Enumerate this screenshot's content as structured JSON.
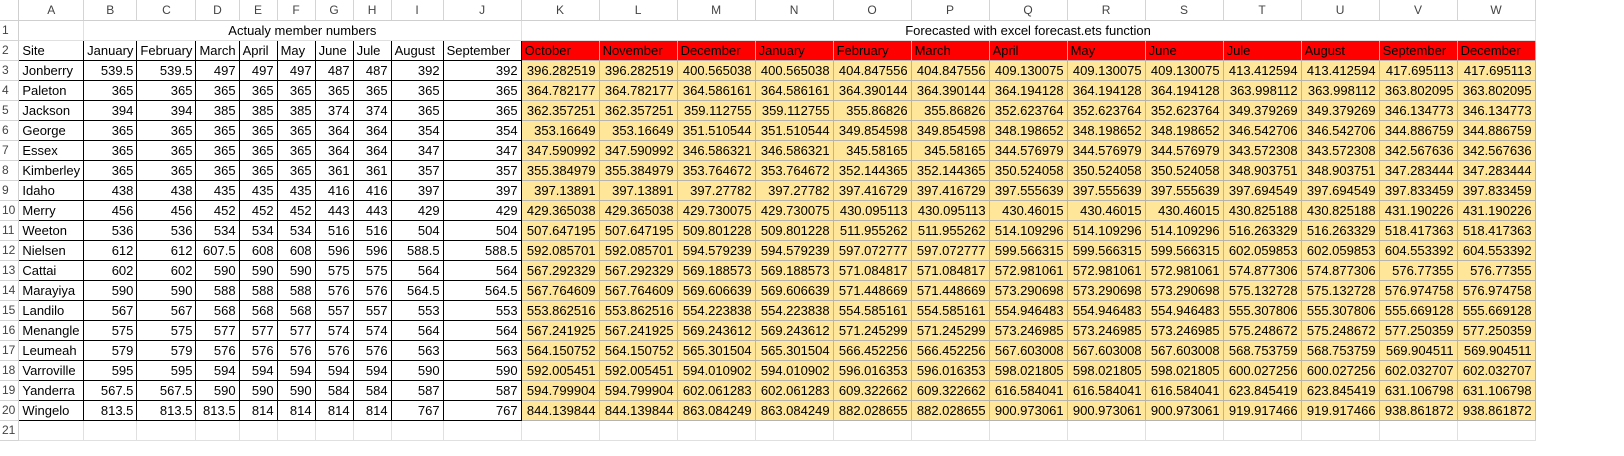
{
  "columns": [
    "A",
    "B",
    "C",
    "D",
    "E",
    "F",
    "G",
    "H",
    "I",
    "J",
    "K",
    "L",
    "M",
    "N",
    "O",
    "P",
    "Q",
    "R",
    "S",
    "T",
    "U",
    "V",
    "W"
  ],
  "titles": {
    "actual": "Actualy member numbers",
    "forecast": "Forecasted with excel forecast.ets function"
  },
  "header": {
    "site": "Site",
    "actual_months": [
      "January",
      "February",
      "March",
      "April",
      "May",
      "June",
      "Jule",
      "August",
      "September"
    ],
    "forecast_months": [
      "October",
      "November",
      "December",
      "January",
      "February",
      "March",
      "April",
      "May",
      "June",
      "Jule",
      "August",
      "September",
      "December"
    ]
  },
  "rows": [
    {
      "site": "Jonberry",
      "actual": [
        "539.5",
        "539.5",
        "497",
        "497",
        "497",
        "487",
        "487",
        "392",
        "392"
      ],
      "forecast": [
        "396.282519",
        "396.282519",
        "400.565038",
        "400.565038",
        "404.847556",
        "404.847556",
        "409.130075",
        "409.130075",
        "409.130075",
        "413.412594",
        "413.412594",
        "417.695113",
        "417.695113"
      ]
    },
    {
      "site": "Paleton",
      "actual": [
        "365",
        "365",
        "365",
        "365",
        "365",
        "365",
        "365",
        "365",
        "365"
      ],
      "forecast": [
        "364.782177",
        "364.782177",
        "364.586161",
        "364.586161",
        "364.390144",
        "364.390144",
        "364.194128",
        "364.194128",
        "364.194128",
        "363.998112",
        "363.998112",
        "363.802095",
        "363.802095"
      ]
    },
    {
      "site": "Jackson",
      "actual": [
        "394",
        "394",
        "385",
        "385",
        "385",
        "374",
        "374",
        "365",
        "365"
      ],
      "forecast": [
        "362.357251",
        "362.357251",
        "359.112755",
        "359.112755",
        "355.86826",
        "355.86826",
        "352.623764",
        "352.623764",
        "352.623764",
        "349.379269",
        "349.379269",
        "346.134773",
        "346.134773"
      ]
    },
    {
      "site": "George",
      "actual": [
        "365",
        "365",
        "365",
        "365",
        "365",
        "364",
        "364",
        "354",
        "354"
      ],
      "forecast": [
        "353.16649",
        "353.16649",
        "351.510544",
        "351.510544",
        "349.854598",
        "349.854598",
        "348.198652",
        "348.198652",
        "348.198652",
        "346.542706",
        "346.542706",
        "344.886759",
        "344.886759"
      ]
    },
    {
      "site": "Essex",
      "actual": [
        "365",
        "365",
        "365",
        "365",
        "365",
        "364",
        "364",
        "347",
        "347"
      ],
      "forecast": [
        "347.590992",
        "347.590992",
        "346.586321",
        "346.586321",
        "345.58165",
        "345.58165",
        "344.576979",
        "344.576979",
        "344.576979",
        "343.572308",
        "343.572308",
        "342.567636",
        "342.567636"
      ]
    },
    {
      "site": "Kimberley",
      "actual": [
        "365",
        "365",
        "365",
        "365",
        "365",
        "361",
        "361",
        "357",
        "357"
      ],
      "forecast": [
        "355.384979",
        "355.384979",
        "353.764672",
        "353.764672",
        "352.144365",
        "352.144365",
        "350.524058",
        "350.524058",
        "350.524058",
        "348.903751",
        "348.903751",
        "347.283444",
        "347.283444"
      ]
    },
    {
      "site": "Idaho",
      "actual": [
        "438",
        "438",
        "435",
        "435",
        "435",
        "416",
        "416",
        "397",
        "397"
      ],
      "forecast": [
        "397.13891",
        "397.13891",
        "397.27782",
        "397.27782",
        "397.416729",
        "397.416729",
        "397.555639",
        "397.555639",
        "397.555639",
        "397.694549",
        "397.694549",
        "397.833459",
        "397.833459"
      ]
    },
    {
      "site": "Merry",
      "actual": [
        "456",
        "456",
        "452",
        "452",
        "452",
        "443",
        "443",
        "429",
        "429"
      ],
      "forecast": [
        "429.365038",
        "429.365038",
        "429.730075",
        "429.730075",
        "430.095113",
        "430.095113",
        "430.46015",
        "430.46015",
        "430.46015",
        "430.825188",
        "430.825188",
        "431.190226",
        "431.190226"
      ]
    },
    {
      "site": "Weeton",
      "actual": [
        "536",
        "536",
        "534",
        "534",
        "534",
        "516",
        "516",
        "504",
        "504"
      ],
      "forecast": [
        "507.647195",
        "507.647195",
        "509.801228",
        "509.801228",
        "511.955262",
        "511.955262",
        "514.109296",
        "514.109296",
        "514.109296",
        "516.263329",
        "516.263329",
        "518.417363",
        "518.417363"
      ]
    },
    {
      "site": "Nielsen",
      "actual": [
        "612",
        "612",
        "607.5",
        "608",
        "608",
        "596",
        "596",
        "588.5",
        "588.5"
      ],
      "forecast": [
        "592.085701",
        "592.085701",
        "594.579239",
        "594.579239",
        "597.072777",
        "597.072777",
        "599.566315",
        "599.566315",
        "599.566315",
        "602.059853",
        "602.059853",
        "604.553392",
        "604.553392"
      ]
    },
    {
      "site": "Cattai",
      "actual": [
        "602",
        "602",
        "590",
        "590",
        "590",
        "575",
        "575",
        "564",
        "564"
      ],
      "forecast": [
        "567.292329",
        "567.292329",
        "569.188573",
        "569.188573",
        "571.084817",
        "571.084817",
        "572.981061",
        "572.981061",
        "572.981061",
        "574.877306",
        "574.877306",
        "576.77355",
        "576.77355"
      ]
    },
    {
      "site": "Marayiya",
      "actual": [
        "590",
        "590",
        "588",
        "588",
        "588",
        "576",
        "576",
        "564.5",
        "564.5"
      ],
      "forecast": [
        "567.764609",
        "567.764609",
        "569.606639",
        "569.606639",
        "571.448669",
        "571.448669",
        "573.290698",
        "573.290698",
        "573.290698",
        "575.132728",
        "575.132728",
        "576.974758",
        "576.974758"
      ]
    },
    {
      "site": "Landilo",
      "actual": [
        "567",
        "567",
        "568",
        "568",
        "568",
        "557",
        "557",
        "553",
        "553"
      ],
      "forecast": [
        "553.862516",
        "553.862516",
        "554.223838",
        "554.223838",
        "554.585161",
        "554.585161",
        "554.946483",
        "554.946483",
        "554.946483",
        "555.307806",
        "555.307806",
        "555.669128",
        "555.669128"
      ]
    },
    {
      "site": "Menangle",
      "actual": [
        "575",
        "575",
        "577",
        "577",
        "577",
        "574",
        "574",
        "564",
        "564"
      ],
      "forecast": [
        "567.241925",
        "567.241925",
        "569.243612",
        "569.243612",
        "571.245299",
        "571.245299",
        "573.246985",
        "573.246985",
        "573.246985",
        "575.248672",
        "575.248672",
        "577.250359",
        "577.250359"
      ]
    },
    {
      "site": "Leumeah",
      "actual": [
        "579",
        "579",
        "576",
        "576",
        "576",
        "576",
        "576",
        "563",
        "563"
      ],
      "forecast": [
        "564.150752",
        "564.150752",
        "565.301504",
        "565.301504",
        "566.452256",
        "566.452256",
        "567.603008",
        "567.603008",
        "567.603008",
        "568.753759",
        "568.753759",
        "569.904511",
        "569.904511"
      ]
    },
    {
      "site": "Varroville",
      "actual": [
        "595",
        "595",
        "594",
        "594",
        "594",
        "594",
        "594",
        "590",
        "590"
      ],
      "forecast": [
        "592.005451",
        "592.005451",
        "594.010902",
        "594.010902",
        "596.016353",
        "596.016353",
        "598.021805",
        "598.021805",
        "598.021805",
        "600.027256",
        "600.027256",
        "602.032707",
        "602.032707"
      ]
    },
    {
      "site": "Yanderra",
      "actual": [
        "567.5",
        "567.5",
        "590",
        "590",
        "590",
        "584",
        "584",
        "587",
        "587"
      ],
      "forecast": [
        "594.799904",
        "594.799904",
        "602.061283",
        "602.061283",
        "609.322662",
        "609.322662",
        "616.584041",
        "616.584041",
        "616.584041",
        "623.845419",
        "623.845419",
        "631.106798",
        "631.106798"
      ]
    },
    {
      "site": "Wingelo",
      "actual": [
        "813.5",
        "813.5",
        "813.5",
        "814",
        "814",
        "814",
        "814",
        "767",
        "767"
      ],
      "forecast": [
        "844.139844",
        "844.139844",
        "863.084249",
        "863.084249",
        "882.028655",
        "882.028655",
        "900.973061",
        "900.973061",
        "900.973061",
        "919.917466",
        "919.917466",
        "938.861872",
        "938.861872"
      ]
    }
  ]
}
